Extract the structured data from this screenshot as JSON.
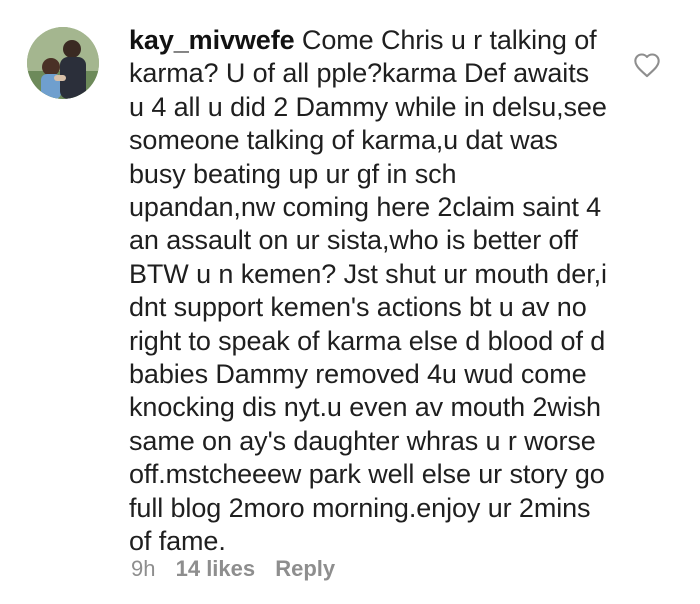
{
  "comment": {
    "username": "kay_mivwefe",
    "text": "Come Chris u r talking of karma? U of all pple?karma Def awaits u 4 all u did 2 Dammy while in delsu,see someone talking of karma,u dat was busy beating up ur gf in sch upandan,nw coming here 2claim saint 4 an assault on ur sista,who is better off BTW u n kemen? Jst shut ur mouth der,i dnt support kemen's actions bt u av no right to speak of karma else d blood of d babies Dammy removed 4u wud come knocking dis nyt.u even av mouth 2wish same on ay's daughter whras u r worse off.mstcheeew park well else ur story go full blog 2moro morning.enjoy ur 2mins of fame.",
    "time": "9h",
    "likes": "14 likes",
    "reply_label": "Reply",
    "avatar_icon": "user-avatar-photo",
    "like_icon": "heart-outline-icon"
  },
  "colors": {
    "text": "#1f1f1f",
    "meta": "#8e8e8e",
    "background": "#ffffff"
  }
}
